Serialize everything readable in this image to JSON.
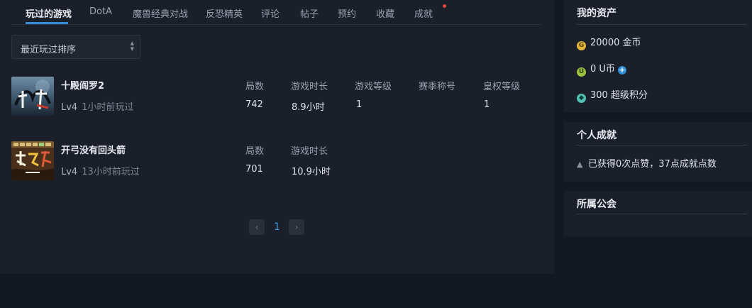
{
  "tabs": [
    {
      "label": "玩过的游戏",
      "active": true
    },
    {
      "label": "DotA"
    },
    {
      "label": "魔兽经典对战"
    },
    {
      "label": "反恐精英"
    },
    {
      "label": "评论"
    },
    {
      "label": "帖子"
    },
    {
      "label": "预约"
    },
    {
      "label": "收藏"
    },
    {
      "label": "成就",
      "has_notification": true
    }
  ],
  "sort": {
    "selected": "最近玩过排序"
  },
  "games": [
    {
      "name": "十殿阎罗2",
      "level": "Lv4",
      "last_played": "1小时前玩过",
      "stats": [
        {
          "header": "局数",
          "value": "742"
        },
        {
          "header": "游戏时长",
          "value": "8.9小时"
        },
        {
          "header": "游戏等级",
          "value": "1"
        },
        {
          "header": "赛季称号",
          "value": ""
        },
        {
          "header": "皇权等级",
          "value": "1"
        }
      ]
    },
    {
      "name": "开弓没有回头箭",
      "level": "Lv4",
      "last_played": "13小时前玩过",
      "stats": [
        {
          "header": "局数",
          "value": "701"
        },
        {
          "header": "游戏时长",
          "value": "10.9小时"
        }
      ]
    }
  ],
  "pagination": {
    "prev": "‹",
    "current": "1",
    "next": "›"
  },
  "assets": {
    "title": "我的资产",
    "gold": {
      "icon": "gold-coin-icon",
      "letter": "G",
      "text": "20000 金币",
      "color": "#e0b53a"
    },
    "ucoin": {
      "icon": "u-coin-icon",
      "letter": "U",
      "text": "0 U币",
      "color": "#9cc23c"
    },
    "points": {
      "icon": "super-points-icon",
      "text": "300 超级积分",
      "color": "#4fc1b0"
    },
    "plus_icon": "add-icon"
  },
  "achievements": {
    "title": "个人成就",
    "icon": "thumbs-up-icon",
    "text": "已获得0次点赞，37点成就点数"
  },
  "guild": {
    "title": "所属公会"
  }
}
